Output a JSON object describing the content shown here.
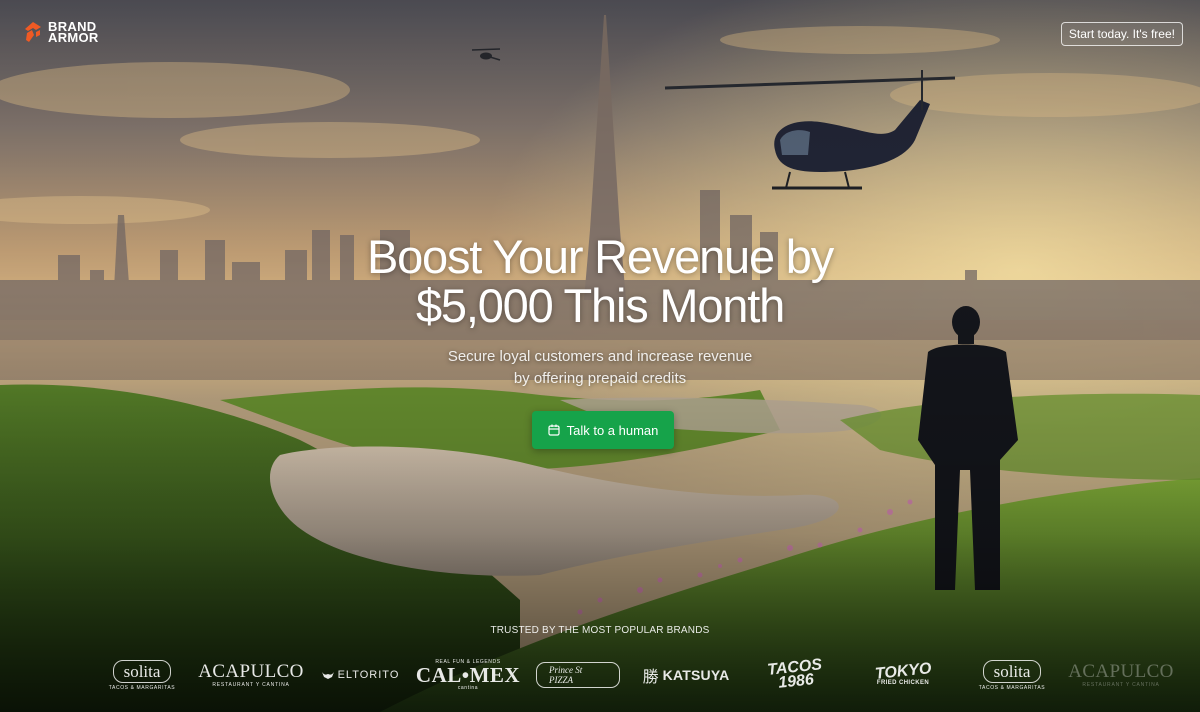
{
  "brand": {
    "logo_line1": "BRAND",
    "logo_line2": "ARMOR",
    "accent_color": "#f05a24"
  },
  "header": {
    "cta_label": "Start today. It's free!"
  },
  "hero": {
    "headline_line1": "Boost Your Revenue by",
    "headline_line2": "$5,000 This Month",
    "subhead_line1": "Secure loyal customers and increase revenue",
    "subhead_line2": "by offering prepaid credits",
    "button_label": "Talk to a human",
    "button_icon": "calendar-icon",
    "button_color": "#16a34a"
  },
  "trusted": {
    "heading": "TRUSTED BY THE MOST POPULAR BRANDS",
    "brands": [
      {
        "name": "solita",
        "tagline": "TACOS & MARGARITAS"
      },
      {
        "name": "ACAPULCO",
        "tagline": "RESTAURANT Y CANTINA"
      },
      {
        "name": "ELTORITO"
      },
      {
        "name": "CAL•MEX",
        "top": "REAL FUN & LEGENDS",
        "tagline": "cantina"
      },
      {
        "name": "Prince St PIZZA"
      },
      {
        "name": "KATSUYA",
        "mark": "勝"
      },
      {
        "name": "TACOS",
        "tagline": "1986"
      },
      {
        "name": "TOKYO",
        "tagline": "FRIED CHICKEN"
      },
      {
        "name": "solita",
        "tagline": "TACOS & MARGARITAS"
      },
      {
        "name": "ACAPULCO",
        "tagline": "RESTAURANT Y CANTINA"
      }
    ]
  }
}
